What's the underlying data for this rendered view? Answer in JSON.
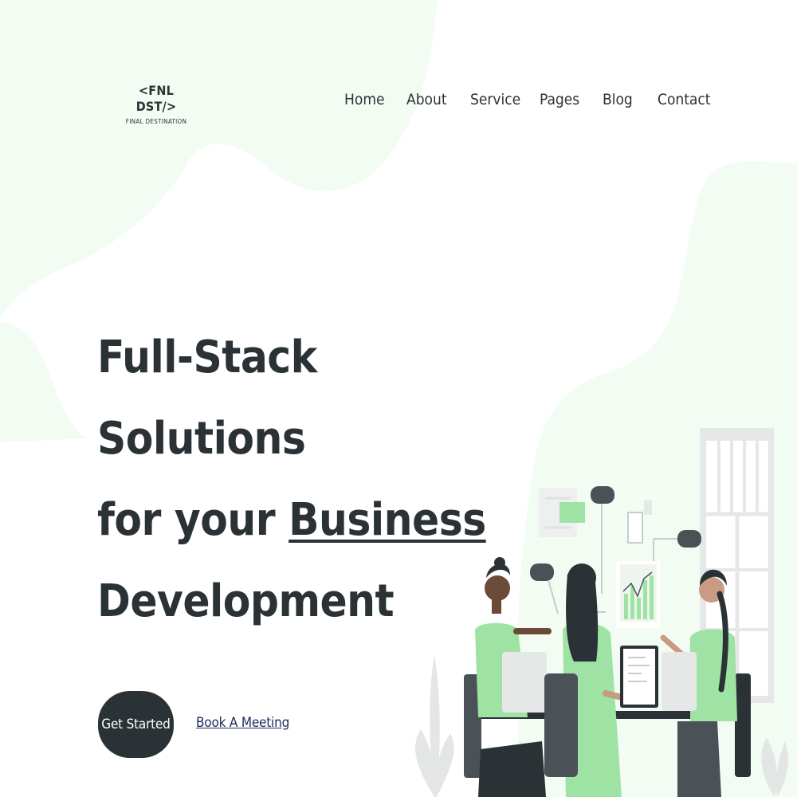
{
  "brand": {
    "logo_text": "<FNL DST/>",
    "tagline": "FINAL DESTINATION"
  },
  "nav": {
    "items": [
      {
        "label": "Home"
      },
      {
        "label": "About"
      },
      {
        "label": "Service"
      },
      {
        "label": "Pages"
      },
      {
        "label": "Blog"
      },
      {
        "label": "Contact"
      }
    ]
  },
  "hero": {
    "line1": "Full-Stack",
    "line2": "Solutions",
    "line3_prefix": "for your ",
    "line3_highlight": "Business",
    "line4": "Development",
    "cta_primary": "Get Started",
    "cta_secondary": "Book A Meeting"
  },
  "colors": {
    "accent_green": "#9ee2a4",
    "background_tint": "#f2fcf3",
    "text_dark": "#2b3236",
    "link_blue": "#1d2b5c"
  },
  "illustration": {
    "subject": "team-meeting-illustration"
  }
}
